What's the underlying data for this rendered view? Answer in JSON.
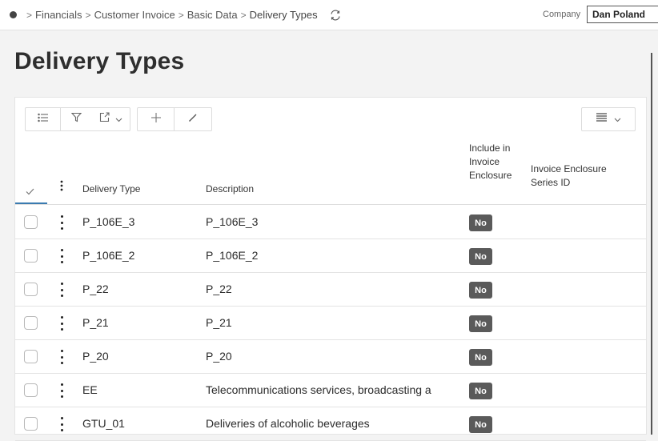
{
  "breadcrumb": {
    "items": [
      "Financials",
      "Customer Invoice",
      "Basic Data",
      "Delivery Types"
    ],
    "separator": ">"
  },
  "company": {
    "label": "Company",
    "value": "Dan Poland"
  },
  "page": {
    "title": "Delivery Types"
  },
  "table": {
    "headers": {
      "delivery_type": "Delivery Type",
      "description": "Description",
      "include_line1": "Include in",
      "include_line2": "Invoice",
      "include_line3": "Enclosure",
      "series_line1": "Invoice Enclosure",
      "series_line2": "Series ID"
    },
    "rows": [
      {
        "delivery_type": "P_106E_3",
        "description": "P_106E_3",
        "include": "No",
        "series_id": ""
      },
      {
        "delivery_type": "P_106E_2",
        "description": "P_106E_2",
        "include": "No",
        "series_id": ""
      },
      {
        "delivery_type": "P_22",
        "description": "P_22",
        "include": "No",
        "series_id": ""
      },
      {
        "delivery_type": "P_21",
        "description": "P_21",
        "include": "No",
        "series_id": ""
      },
      {
        "delivery_type": "P_20",
        "description": "P_20",
        "include": "No",
        "series_id": ""
      },
      {
        "delivery_type": "EE",
        "description": "Telecommunications services, broadcasting a",
        "include": "No",
        "series_id": ""
      },
      {
        "delivery_type": "GTU_01",
        "description": "Deliveries of alcoholic beverages",
        "include": "No",
        "series_id": ""
      }
    ]
  },
  "icons": {
    "refresh": "refresh-icon",
    "list": "list-icon",
    "filter": "filter-icon",
    "export": "export-icon",
    "add": "plus-icon",
    "edit": "pencil-icon",
    "columns": "table-columns-icon"
  },
  "colors": {
    "badge_bg": "#5a5a5a",
    "accent": "#3b7bb0"
  }
}
